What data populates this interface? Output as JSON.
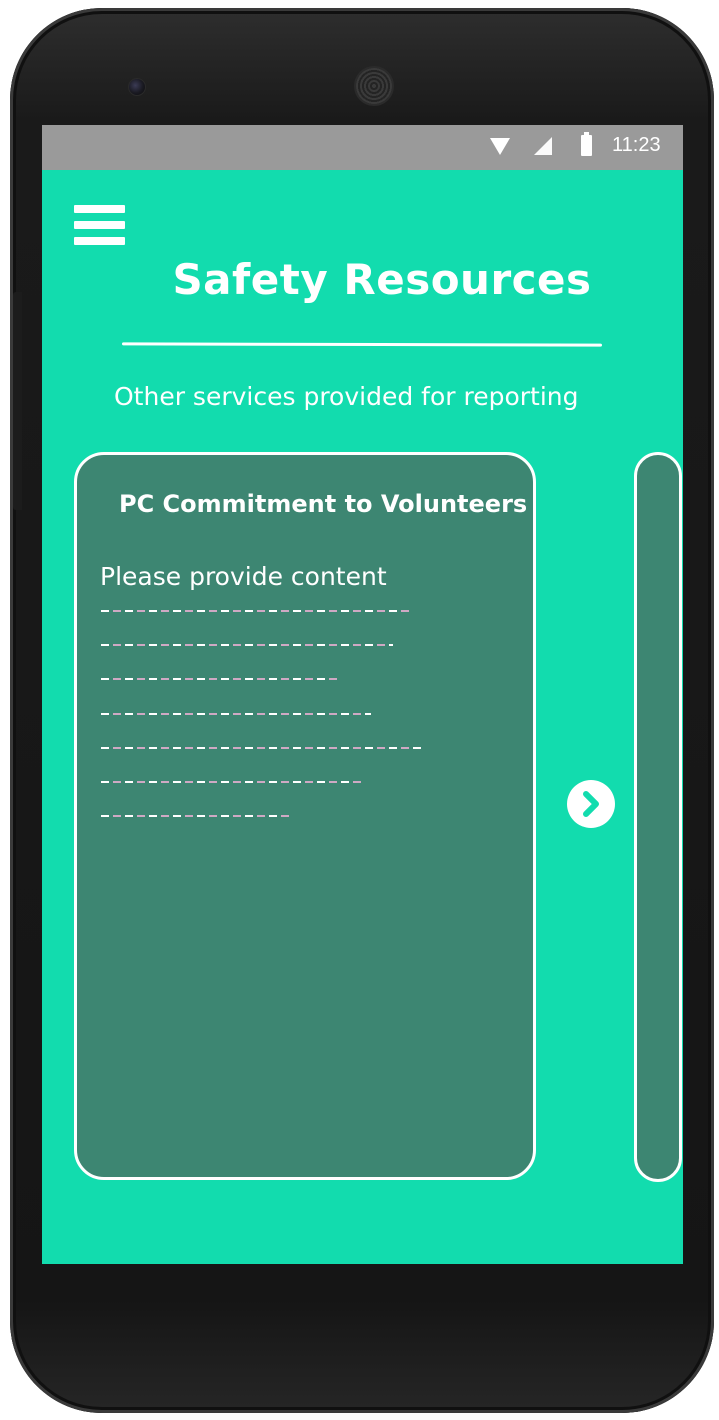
{
  "status_bar": {
    "time": "11:23",
    "icons": [
      "wifi-icon",
      "signal-icon",
      "battery-icon"
    ]
  },
  "header": {
    "menu_icon": "hamburger-menu-icon",
    "title": "Safety Resources",
    "subtitle": "Other services provided for reporting"
  },
  "card": {
    "title": "PC Commitment to Volunteers",
    "prompt": "Please provide content",
    "placeholder_lines": 7
  },
  "navigation": {
    "next_icon": "chevron-right-icon"
  },
  "colors": {
    "screen_background": "#12dcae",
    "card_background": "#3d8672",
    "status_bar": "#9a9a9a",
    "text": "#ffffff"
  }
}
